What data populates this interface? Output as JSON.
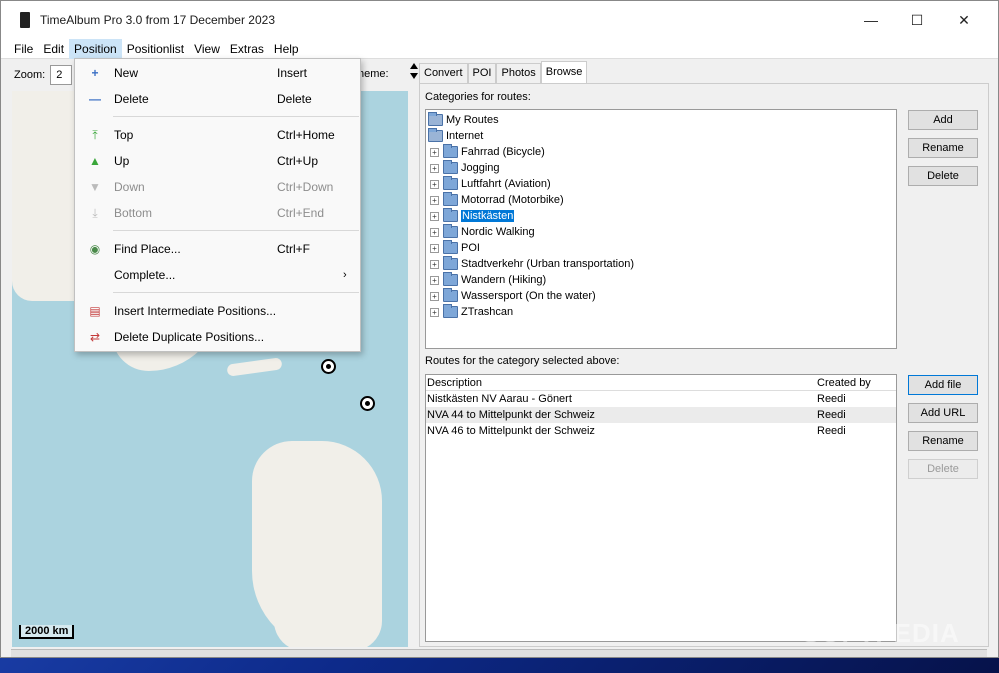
{
  "window": {
    "title": "TimeAlbum Pro 3.0 from 17 December 2023",
    "controls": {
      "minimize": "—",
      "maximize": "☐",
      "close": "✕"
    }
  },
  "menubar": [
    "File",
    "Edit",
    "Position",
    "Positionlist",
    "View",
    "Extras",
    "Help"
  ],
  "map": {
    "zoom_label": "Zoom:",
    "zoom_value": "2",
    "scheme_label": "heme:",
    "scale_text": "2000 km",
    "colors": {
      "water": "#abd3df",
      "land": "#f1efe9"
    }
  },
  "dropdown": {
    "items": [
      {
        "label": "New",
        "shortcut": "Insert",
        "icon": "plus-icon",
        "enabled": true
      },
      {
        "label": "Delete",
        "shortcut": "Delete",
        "icon": "minus-icon",
        "enabled": true
      },
      {
        "label": "Top",
        "shortcut": "Ctrl+Home",
        "icon": "arrow-top-icon",
        "enabled": true
      },
      {
        "label": "Up",
        "shortcut": "Ctrl+Up",
        "icon": "arrow-up-icon",
        "enabled": true
      },
      {
        "label": "Down",
        "shortcut": "Ctrl+Down",
        "icon": "arrow-down-icon",
        "enabled": false
      },
      {
        "label": "Bottom",
        "shortcut": "Ctrl+End",
        "icon": "arrow-bottom-icon",
        "enabled": false
      },
      {
        "label": "Find Place...",
        "shortcut": "Ctrl+F",
        "icon": "globe-icon",
        "enabled": true
      },
      {
        "label": "Complete...",
        "shortcut": "",
        "icon": "",
        "enabled": true,
        "submenu": true
      },
      {
        "label": "Insert Intermediate Positions...",
        "shortcut": "",
        "icon": "insert-doc-icon",
        "enabled": true
      },
      {
        "label": "Delete Duplicate Positions...",
        "shortcut": "",
        "icon": "delete-dup-icon",
        "enabled": true
      }
    ]
  },
  "tabs": [
    "Convert",
    "POI",
    "Photos",
    "Browse"
  ],
  "active_tab": "Browse",
  "categories": {
    "label": "Categories for routes:",
    "tree": [
      {
        "label": "My Routes",
        "level": 0,
        "expander": false
      },
      {
        "label": "Internet",
        "level": 0,
        "expander": false
      },
      {
        "label": "Fahrrad (Bicycle)",
        "level": 1,
        "expander": true
      },
      {
        "label": "Jogging",
        "level": 1,
        "expander": true
      },
      {
        "label": "Luftfahrt (Aviation)",
        "level": 1,
        "expander": true
      },
      {
        "label": "Motorrad (Motorbike)",
        "level": 1,
        "expander": true
      },
      {
        "label": "Nistkästen",
        "level": 1,
        "expander": true,
        "selected": true
      },
      {
        "label": "Nordic Walking",
        "level": 1,
        "expander": true
      },
      {
        "label": "POI",
        "level": 1,
        "expander": true
      },
      {
        "label": "Stadtverkehr (Urban transportation)",
        "level": 1,
        "expander": true
      },
      {
        "label": "Wandern (Hiking)",
        "level": 1,
        "expander": true
      },
      {
        "label": "Wassersport (On the water)",
        "level": 1,
        "expander": true
      },
      {
        "label": "ZTrashcan",
        "level": 1,
        "expander": true
      }
    ],
    "buttons": {
      "add": "Add",
      "rename": "Rename",
      "delete": "Delete"
    }
  },
  "routes": {
    "label": "Routes for the category selected above:",
    "columns": [
      "Description",
      "Created by"
    ],
    "rows": [
      [
        "Nistkästen NV Aarau - Gönert",
        "Reedi"
      ],
      [
        "NVA 44 to Mittelpunkt der Schweiz",
        "Reedi"
      ],
      [
        "NVA 46 to Mittelpunkt der Schweiz",
        "Reedi"
      ]
    ],
    "buttons": {
      "add_file": "Add file",
      "add_url": "Add URL",
      "rename": "Rename",
      "delete": "Delete"
    }
  },
  "watermark": "SOFTPEDIA"
}
